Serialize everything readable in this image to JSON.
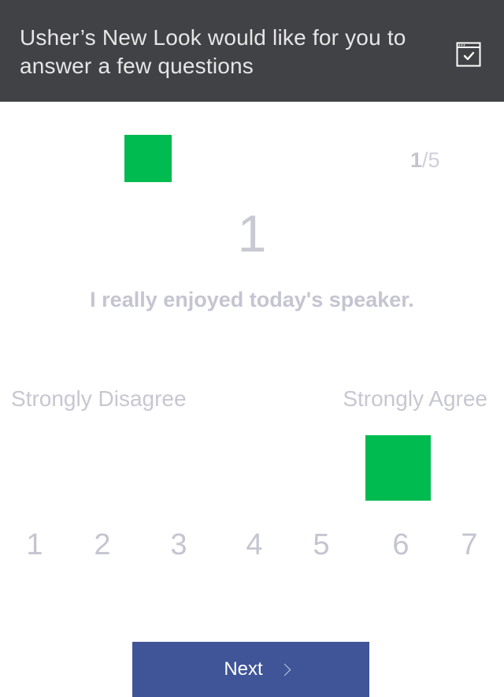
{
  "header": {
    "title": "Usher’s New Look would like for you to answer a few questions",
    "icon": "calendar-check-icon"
  },
  "progress": {
    "current": "1",
    "separator": "/",
    "total": "5",
    "marker_color": "#00bb4f"
  },
  "question": {
    "number": "1",
    "text": "I really enjoyed today's speaker."
  },
  "scale": {
    "min_label": "Strongly Disagree",
    "max_label": "Strongly Agree",
    "options": [
      "1",
      "2",
      "3",
      "4",
      "5",
      "6",
      "7"
    ],
    "selected": "6",
    "selected_color": "#00bb4f"
  },
  "next_button": {
    "label": "Next",
    "icon": "chevron-right-icon",
    "color": "#3f5597"
  },
  "colors": {
    "header_bg": "#414245",
    "text_muted": "#c5c5d1"
  }
}
